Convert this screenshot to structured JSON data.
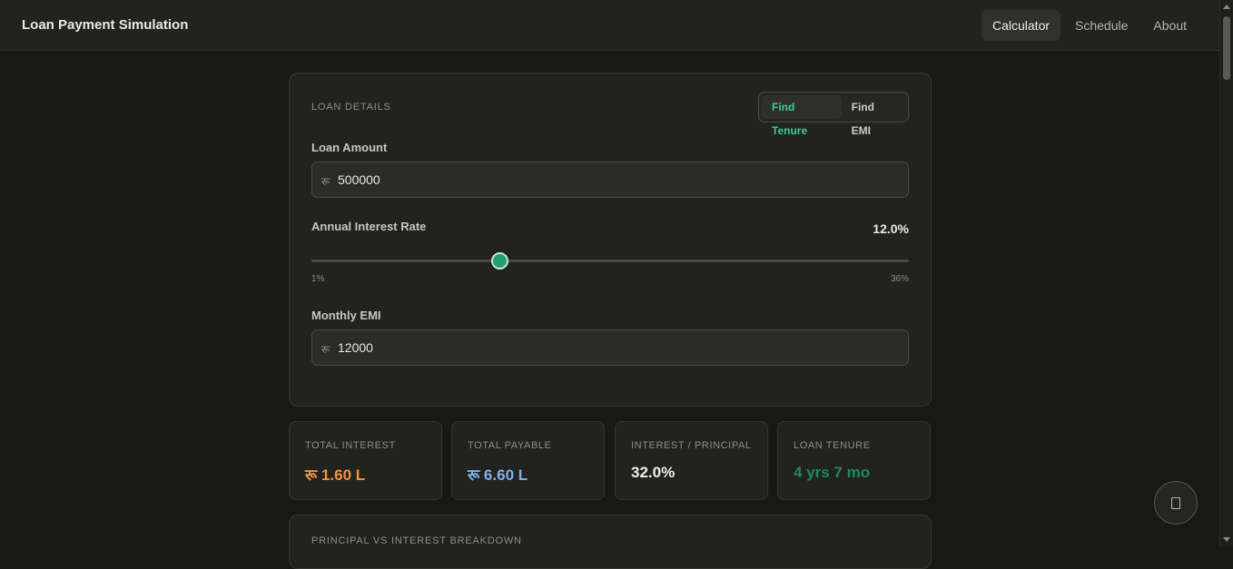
{
  "app": {
    "title": "Loan Payment Simulation"
  },
  "nav": [
    {
      "label": "Calculator",
      "active": true
    },
    {
      "label": "Schedule",
      "active": false
    },
    {
      "label": "About",
      "active": false
    }
  ],
  "loan_details": {
    "section_label": "LOAN DETAILS",
    "mode_toggle": {
      "options": [
        "Find Tenure",
        "Find EMI"
      ],
      "selected": "Find Tenure"
    },
    "loan_amount": {
      "label": "Loan Amount",
      "currency_symbol": "रू",
      "value": "500000"
    },
    "interest_rate": {
      "label": "Annual Interest Rate",
      "value_display": "12.0%",
      "value": 12.0,
      "min": 1,
      "max": 36,
      "min_label": "1%",
      "max_label": "36%"
    },
    "monthly_emi": {
      "label": "Monthly EMI",
      "currency_symbol": "रू",
      "value": "12000"
    }
  },
  "stats": [
    {
      "label": "TOTAL INTEREST",
      "value": "रू 1.60 L",
      "color": "#f0963a"
    },
    {
      "label": "TOTAL PAYABLE",
      "value": "रू 6.60 L",
      "color": "#7fb2ec"
    },
    {
      "label": "INTEREST / PRINCIPAL",
      "value": "32.0%",
      "color": "#f2efe6"
    },
    {
      "label": "LOAN TENURE",
      "value": "4 yrs 7 mo",
      "color": "#1e8a5f"
    }
  ],
  "breakdown": {
    "section_label": "PRINCIPAL VS INTEREST BREAKDOWN"
  },
  "colors": {
    "accent": "#44c793",
    "slider_thumb": "#1fa06e",
    "background": "#181816"
  },
  "fab": {
    "icon": "document-icon"
  }
}
